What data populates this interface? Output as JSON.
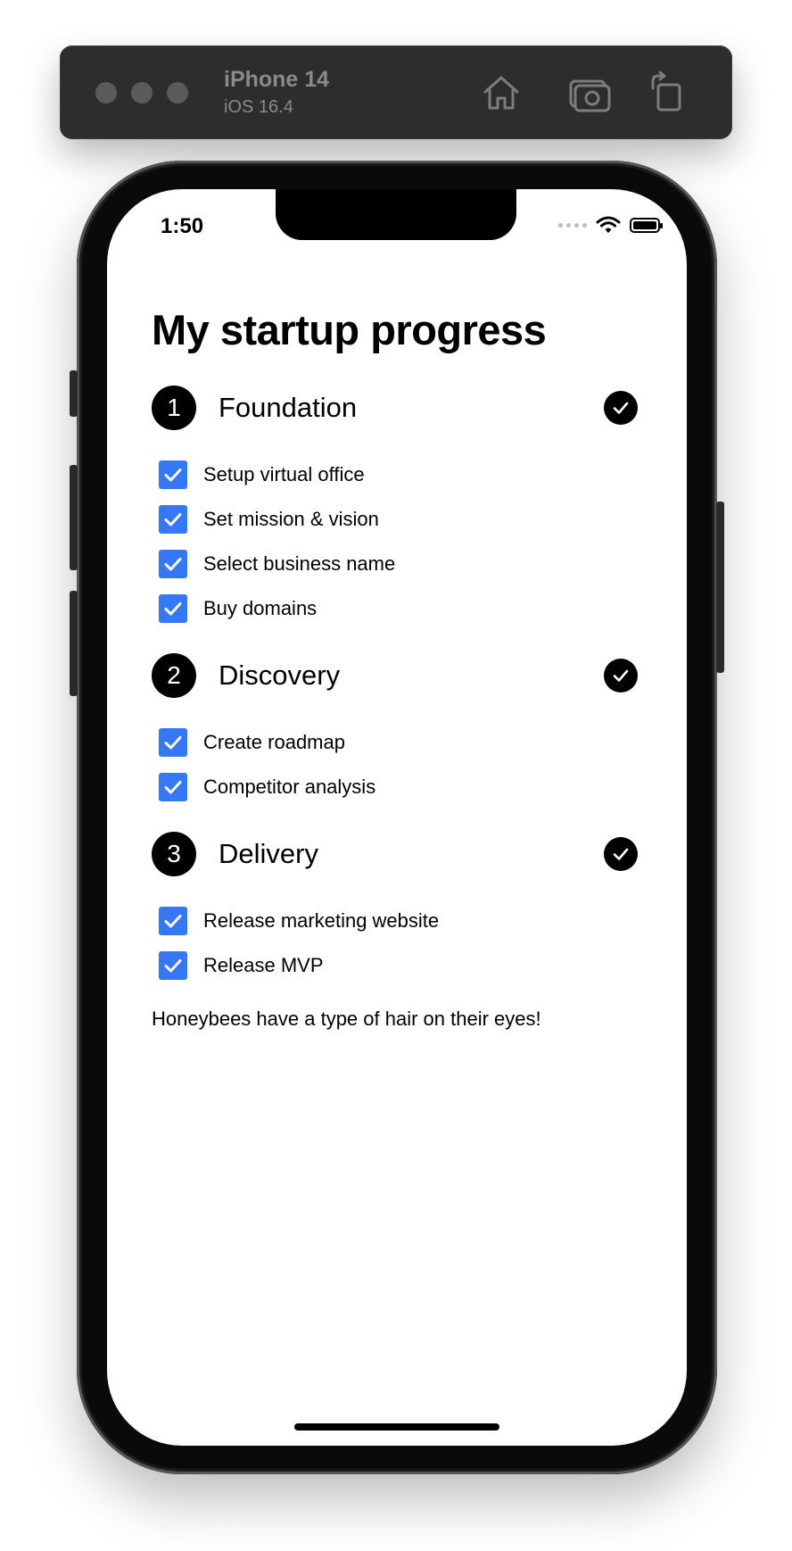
{
  "simulator": {
    "device_name": "iPhone 14",
    "os_version": "iOS 16.4",
    "buttons": [
      "home-icon",
      "screenshot-icon",
      "rotate-icon"
    ]
  },
  "status_bar": {
    "time": "1:50",
    "icons": [
      "signal-dots-icon",
      "wifi-icon",
      "battery-icon"
    ]
  },
  "app": {
    "title": "My startup progress",
    "phases": [
      {
        "number": "1",
        "title": "Foundation",
        "completed": true,
        "tasks": [
          {
            "label": "Setup virtual office",
            "checked": true
          },
          {
            "label": "Set mission & vision",
            "checked": true
          },
          {
            "label": "Select business name",
            "checked": true
          },
          {
            "label": "Buy domains",
            "checked": true
          }
        ]
      },
      {
        "number": "2",
        "title": "Discovery",
        "completed": true,
        "tasks": [
          {
            "label": "Create roadmap",
            "checked": true
          },
          {
            "label": "Competitor analysis",
            "checked": true
          }
        ]
      },
      {
        "number": "3",
        "title": "Delivery",
        "completed": true,
        "tasks": [
          {
            "label": "Release marketing website",
            "checked": true
          },
          {
            "label": "Release MVP",
            "checked": true
          }
        ]
      }
    ],
    "fact": "Honeybees have a type of hair on their eyes!"
  },
  "colors": {
    "checkbox": "#3478f6",
    "badge": "#000000",
    "toolbar": "#2d2d2d"
  }
}
